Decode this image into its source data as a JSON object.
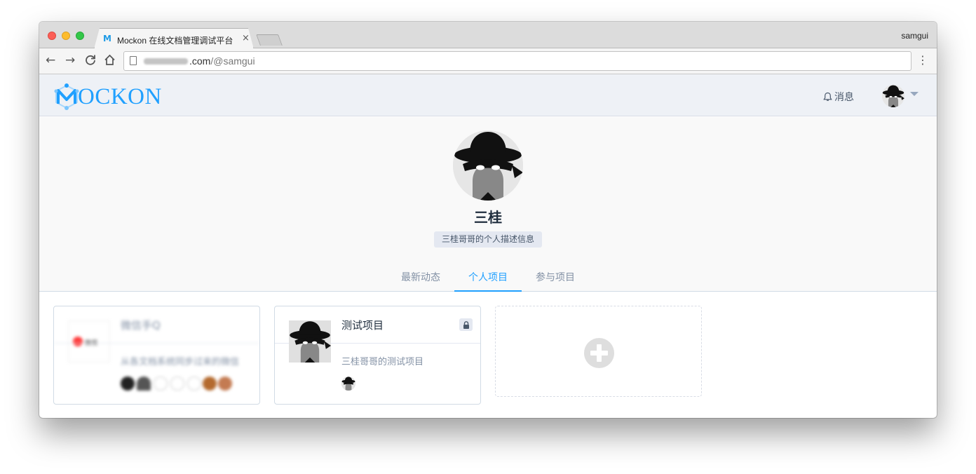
{
  "browser": {
    "tab_title": "Mockon 在线文档管理调试平台",
    "tab_favicon": "M",
    "tab_close": "×",
    "profile_name": "samgui",
    "url_domain_suffix": ".com",
    "url_path": "/@samgui",
    "nav_back": "←",
    "nav_forward": "→",
    "nav_reload": "C",
    "nav_home": "⌂",
    "menu": "⋮"
  },
  "header": {
    "logo_text": "OCKON",
    "notice_label": "消息",
    "icons": {
      "logo": "mockon-logo-icon",
      "notice": "bell-icon",
      "user": "avatar",
      "menu": "caret-down-icon"
    },
    "accent_color": "#20a0ff"
  },
  "profile": {
    "name": "三桂",
    "description": "三桂哥哥的个人描述信息",
    "tabs": [
      {
        "label": "最新动态",
        "active": false
      },
      {
        "label": "个人项目",
        "active": true
      },
      {
        "label": "参与项目",
        "active": false
      }
    ]
  },
  "projects": [
    {
      "title": "微信手Q",
      "description": "从各文档系统同步过来的微信",
      "logo_text": "微视",
      "blurred": true,
      "locked": false
    },
    {
      "title": "测试项目",
      "description": "三桂哥哥的测试项目",
      "blurred": false,
      "locked": true,
      "lock_icon": "lock-icon"
    }
  ],
  "add_project": {
    "icon": "plus-circle-icon"
  }
}
